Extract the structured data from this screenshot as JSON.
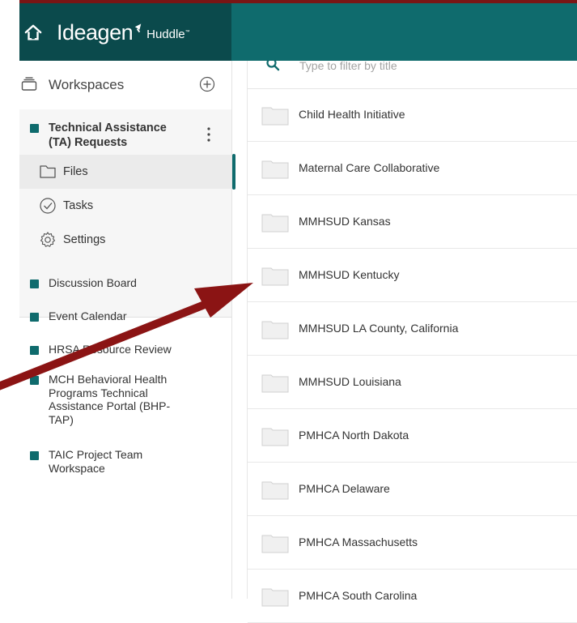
{
  "colors": {
    "header_dark": "#0b4a4c",
    "header_teal": "#0f6b6d",
    "workspace_square": "#0f6b6d",
    "annotation_arrow": "#8b1414",
    "outer_frame": "#7a1515"
  },
  "header": {
    "logo_text": "Ideagen",
    "logo_sub": "Huddle",
    "logo_tm": "™",
    "home_icon": "home-icon"
  },
  "sidebar": {
    "workspaces_label": "Workspaces",
    "active_workspace": {
      "title": "Technical Assistance (TA) Requests",
      "items": [
        {
          "label": "Files",
          "icon": "folder-icon",
          "active": true
        },
        {
          "label": "Tasks",
          "icon": "check-circle-icon",
          "active": false
        },
        {
          "label": "Settings",
          "icon": "gear-icon",
          "active": false
        }
      ]
    },
    "workspaces": [
      {
        "label": "Discussion Board"
      },
      {
        "label": "Event Calendar"
      },
      {
        "label": "HRSA Resource Review"
      },
      {
        "label": "MCH Behavioral Health Programs Technical Assistance Portal (BHP-TAP)"
      },
      {
        "label": "TAIC Project Team Workspace"
      }
    ]
  },
  "main": {
    "filter_placeholder": "Type to filter by title",
    "folders": [
      "Child Health Initiative",
      "Maternal Care Collaborative",
      "MMHSUD Kansas",
      "MMHSUD Kentucky",
      "MMHSUD LA County, California",
      "MMHSUD Louisiana",
      "PMHCA North Dakota",
      "PMHCA Delaware",
      "PMHCA Massachusetts",
      "PMHCA South Carolina"
    ]
  }
}
